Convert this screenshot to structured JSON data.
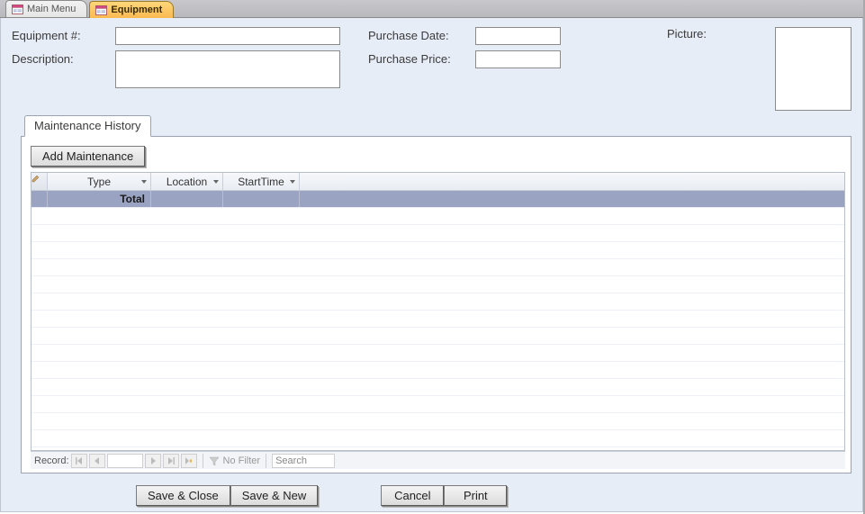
{
  "tabs": {
    "main_menu": "Main Menu",
    "equipment": "Equipment"
  },
  "fields": {
    "equipment_no_label": "Equipment #:",
    "equipment_no_value": "",
    "description_label": "Description:",
    "description_value": "",
    "purchase_date_label": "Purchase Date:",
    "purchase_date_value": "",
    "purchase_price_label": "Purchase Price:",
    "purchase_price_value": "",
    "picture_label": "Picture:"
  },
  "subform": {
    "tab_label": "Maintenance History",
    "add_button": "Add Maintenance",
    "columns": {
      "type": "Type",
      "location": "Location",
      "start_time": "StartTime"
    },
    "total_label": "Total",
    "recnav": {
      "label": "Record:",
      "no_filter": "No Filter",
      "search_placeholder": "Search"
    }
  },
  "buttons": {
    "save_close": "Save & Close",
    "save_new": "Save & New",
    "cancel": "Cancel",
    "print": "Print"
  }
}
